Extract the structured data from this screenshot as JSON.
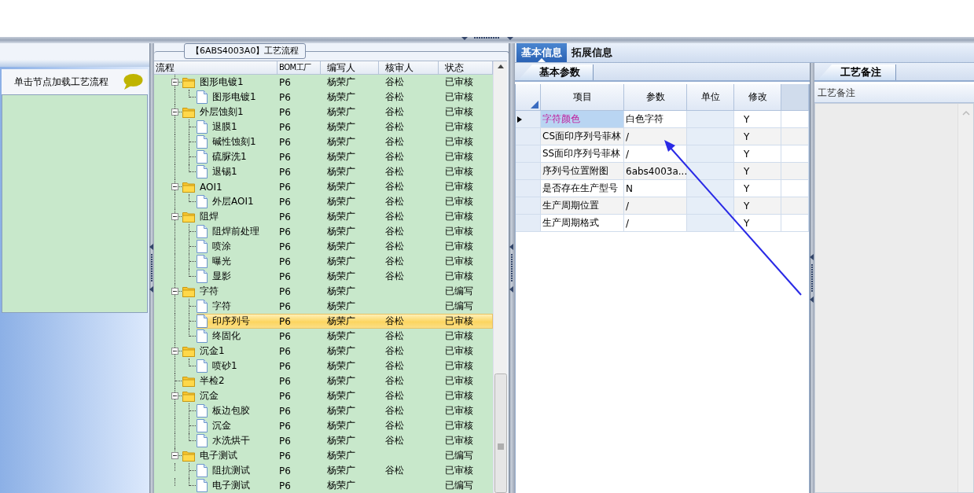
{
  "left_panel": {
    "hint": "单击节点加载工艺流程"
  },
  "flow_panel": {
    "title": "【6ABS4003A0】工艺流程",
    "columns": [
      "流程",
      "BOM工厂",
      "编写人",
      "核审人",
      "状态"
    ],
    "rows": [
      {
        "name": "图形电镀1",
        "kind": "folder",
        "expanded": true,
        "selected": false,
        "bom": "P6",
        "writer": "杨荣广",
        "reviewer": "谷松",
        "status": "已审核",
        "children": [
          {
            "name": "图形电镀1",
            "kind": "file",
            "selected": false,
            "bom": "P6",
            "writer": "杨荣广",
            "reviewer": "谷松",
            "status": "已审核"
          }
        ]
      },
      {
        "name": "外层蚀刻1",
        "kind": "folder",
        "expanded": true,
        "selected": false,
        "bom": "P6",
        "writer": "杨荣广",
        "reviewer": "谷松",
        "status": "已审核",
        "children": [
          {
            "name": "退膜1",
            "kind": "file",
            "selected": false,
            "bom": "P6",
            "writer": "杨荣广",
            "reviewer": "谷松",
            "status": "已审核"
          },
          {
            "name": "碱性蚀刻1",
            "kind": "file",
            "selected": false,
            "bom": "P6",
            "writer": "杨荣广",
            "reviewer": "谷松",
            "status": "已审核"
          },
          {
            "name": "硫脲洗1",
            "kind": "file",
            "selected": false,
            "bom": "P6",
            "writer": "杨荣广",
            "reviewer": "谷松",
            "status": "已审核"
          },
          {
            "name": "退锡1",
            "kind": "file",
            "selected": false,
            "bom": "P6",
            "writer": "杨荣广",
            "reviewer": "谷松",
            "status": "已审核"
          }
        ]
      },
      {
        "name": "AOI1",
        "kind": "folder",
        "expanded": true,
        "selected": false,
        "bom": "P6",
        "writer": "杨荣广",
        "reviewer": "谷松",
        "status": "已审核",
        "children": [
          {
            "name": "外层AOI1",
            "kind": "file",
            "selected": false,
            "bom": "P6",
            "writer": "杨荣广",
            "reviewer": "谷松",
            "status": "已审核"
          }
        ]
      },
      {
        "name": "阻焊",
        "kind": "folder",
        "expanded": true,
        "selected": false,
        "bom": "P6",
        "writer": "杨荣广",
        "reviewer": "谷松",
        "status": "已审核",
        "children": [
          {
            "name": "阻焊前处理",
            "kind": "file",
            "selected": false,
            "bom": "P6",
            "writer": "杨荣广",
            "reviewer": "谷松",
            "status": "已审核"
          },
          {
            "name": "喷涂",
            "kind": "file",
            "selected": false,
            "bom": "P6",
            "writer": "杨荣广",
            "reviewer": "谷松",
            "status": "已审核"
          },
          {
            "name": "曝光",
            "kind": "file",
            "selected": false,
            "bom": "P6",
            "writer": "杨荣广",
            "reviewer": "谷松",
            "status": "已审核"
          },
          {
            "name": "显影",
            "kind": "file",
            "selected": false,
            "bom": "P6",
            "writer": "杨荣广",
            "reviewer": "谷松",
            "status": "已审核"
          }
        ]
      },
      {
        "name": "字符",
        "kind": "folder",
        "expanded": true,
        "selected": false,
        "bom": "P6",
        "writer": "杨荣广",
        "status": "已编写",
        "children": [
          {
            "name": "字符",
            "kind": "file",
            "selected": false,
            "bom": "P6",
            "writer": "杨荣广",
            "status": "已编写"
          },
          {
            "name": "印序列号",
            "kind": "file",
            "selected": true,
            "bom": "P6",
            "writer": "杨荣广",
            "reviewer": "谷松",
            "status": "已审核"
          },
          {
            "name": "终固化",
            "kind": "file",
            "selected": false,
            "bom": "P6",
            "writer": "杨荣广",
            "reviewer": "谷松",
            "status": "已审核"
          }
        ]
      },
      {
        "name": "沉金1",
        "kind": "folder",
        "expanded": true,
        "selected": false,
        "bom": "P6",
        "writer": "杨荣广",
        "reviewer": "谷松",
        "status": "已审核",
        "children": [
          {
            "name": "喷砂1",
            "kind": "file",
            "selected": false,
            "bom": "P6",
            "writer": "杨荣广",
            "reviewer": "谷松",
            "status": "已审核"
          }
        ]
      },
      {
        "name": "半检2",
        "kind": "folder",
        "selected": false,
        "bom": "P6",
        "writer": "杨荣广",
        "reviewer": "谷松",
        "status": "已审核"
      },
      {
        "name": "沉金",
        "kind": "folder",
        "expanded": true,
        "selected": false,
        "bom": "P6",
        "writer": "杨荣广",
        "reviewer": "谷松",
        "status": "已审核",
        "children": [
          {
            "name": "板边包胶",
            "kind": "file",
            "selected": false,
            "bom": "P6",
            "writer": "杨荣广",
            "reviewer": "谷松",
            "status": "已审核"
          },
          {
            "name": "沉金",
            "kind": "file",
            "selected": false,
            "bom": "P6",
            "writer": "杨荣广",
            "reviewer": "谷松",
            "status": "已审核"
          },
          {
            "name": "水洗烘干",
            "kind": "file",
            "selected": false,
            "bom": "P6",
            "writer": "杨荣广",
            "reviewer": "谷松",
            "status": "已审核"
          }
        ]
      },
      {
        "name": "电子测试",
        "kind": "folder",
        "expanded": true,
        "selected": false,
        "bom": "P6",
        "writer": "杨荣广",
        "status": "已编写",
        "children": [
          {
            "name": "阻抗测试",
            "kind": "file",
            "selected": false,
            "bom": "P6",
            "writer": "杨荣广",
            "reviewer": "谷松",
            "status": "已审核"
          },
          {
            "name": "电子测试",
            "kind": "file",
            "selected": false,
            "bom": "P6",
            "writer": "杨荣广",
            "status": "已编写"
          }
        ]
      }
    ]
  },
  "detail": {
    "tabs": [
      {
        "label": "基本信息",
        "selected": true
      },
      {
        "label": "拓展信息",
        "selected": false
      }
    ],
    "params": {
      "tab": "基本参数",
      "columns": [
        "项目",
        "参数",
        "单位",
        "修改"
      ],
      "rows": [
        {
          "item": "字符颜色",
          "value": "白色字符",
          "modified": "Y",
          "selected": true
        },
        {
          "item": "CS面印序列号菲林",
          "value": "/",
          "modified": "Y",
          "selected": false
        },
        {
          "item": "SS面印序列号菲林",
          "value": "/",
          "modified": "Y",
          "selected": false
        },
        {
          "item": "序列号位置附图",
          "value": "6abs4003a...",
          "modified": "Y",
          "selected": false
        },
        {
          "item": "是否存在生产型号",
          "value": "N",
          "modified": "Y",
          "selected": false
        },
        {
          "item": "生产周期位置",
          "value": "/",
          "modified": "Y",
          "selected": false
        },
        {
          "item": "生产周期格式",
          "value": "/",
          "modified": "Y",
          "selected": false
        }
      ]
    }
  },
  "notes": {
    "tab": "工艺备注",
    "column": "工艺备注"
  }
}
